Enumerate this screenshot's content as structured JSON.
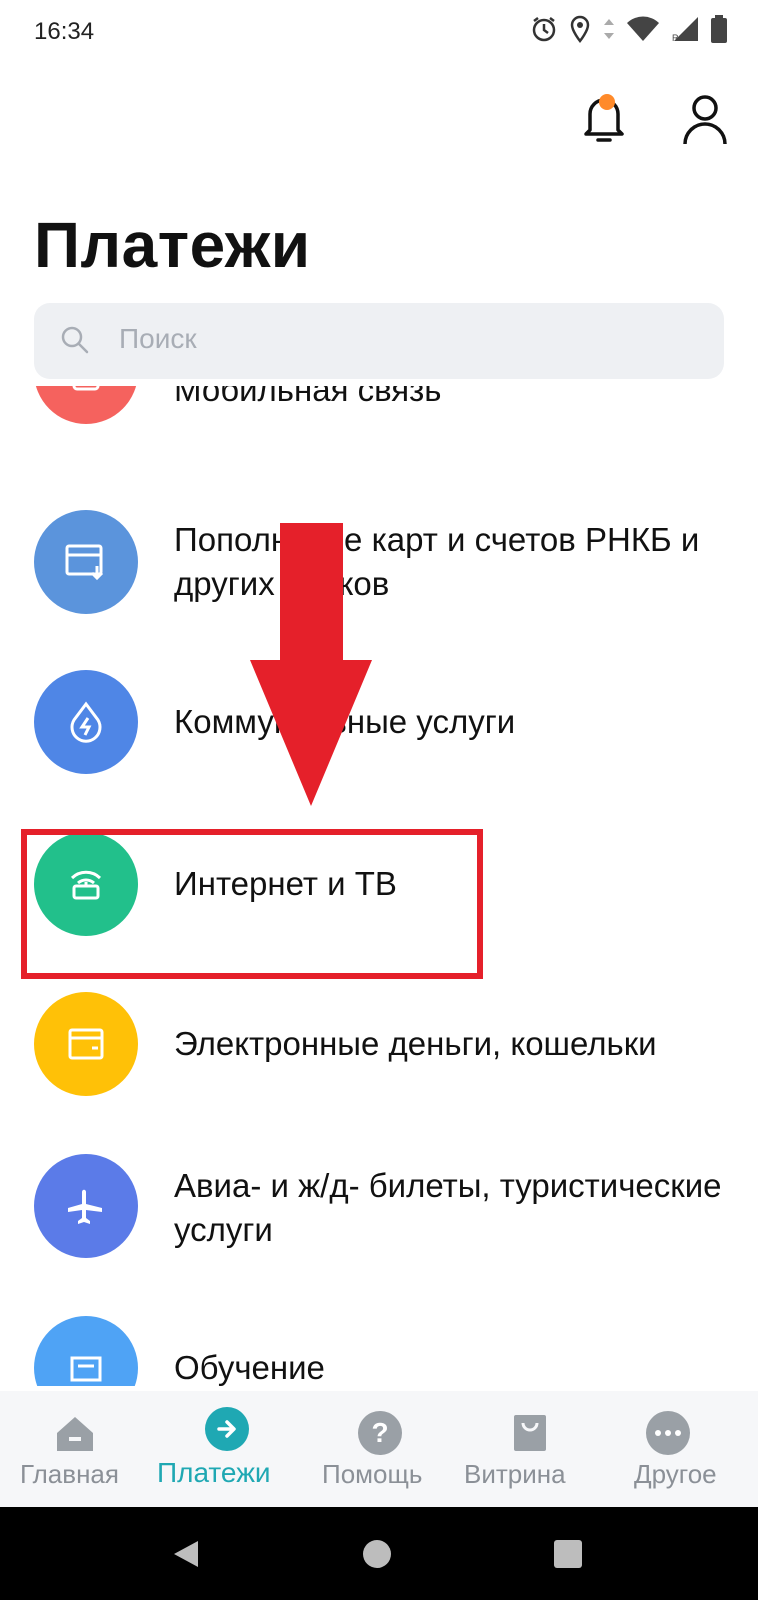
{
  "status_bar": {
    "time": "16:34"
  },
  "header": {
    "title": "Платежи"
  },
  "search": {
    "placeholder": "Поиск"
  },
  "categories": [
    {
      "label": "Мобильная связь",
      "color": "#f5625e",
      "icon": "phone-icon"
    },
    {
      "label": "Пополнение карт и счетов РНКБ и других банков",
      "color": "#5b94dc",
      "icon": "card-download-icon"
    },
    {
      "label": "Коммунальные услуги",
      "color": "#4f86e6",
      "icon": "utility-drop-icon"
    },
    {
      "label": "Интернет и ТВ",
      "color": "#22c08b",
      "icon": "router-icon"
    },
    {
      "label": "Электронные деньги, кошельки",
      "color": "#ffc107",
      "icon": "wallet-icon"
    },
    {
      "label": "Авиа- и ж/д- билеты, туристические услуги",
      "color": "#5b7be8",
      "icon": "airplane-icon"
    },
    {
      "label": "Обучение",
      "color": "#4fa3f5",
      "icon": "education-icon"
    }
  ],
  "bottom_nav": {
    "items": [
      {
        "label": "Главная",
        "icon": "home-icon"
      },
      {
        "label": "Платежи",
        "icon": "arrow-right-icon",
        "active": true
      },
      {
        "label": "Помощь",
        "icon": "help-icon"
      },
      {
        "label": "Витрина",
        "icon": "shopping-bag-icon"
      },
      {
        "label": "Другое",
        "icon": "more-icon"
      }
    ],
    "active_color": "#1fa8b3",
    "inactive_color": "#8b9097"
  },
  "annotation": {
    "highlight_color": "#e5202a"
  }
}
